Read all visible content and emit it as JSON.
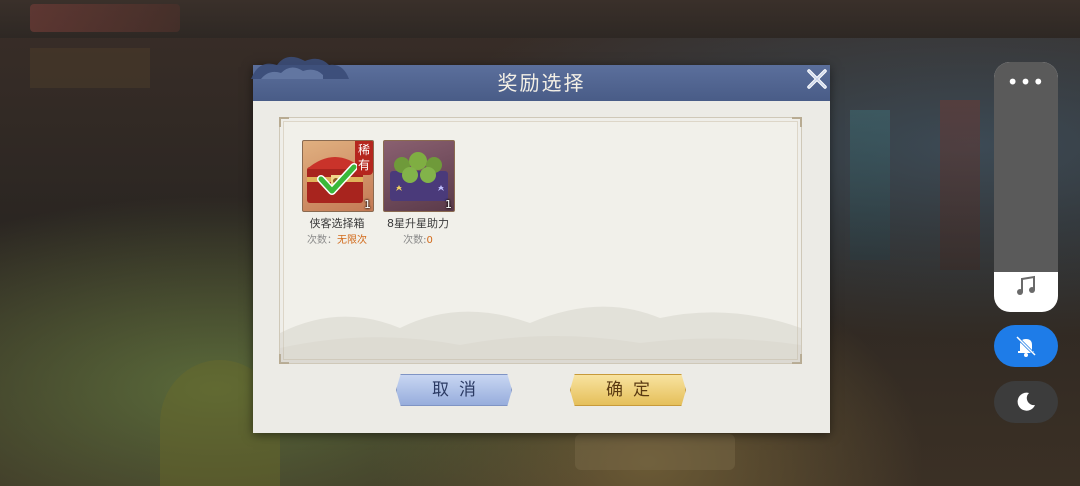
{
  "dialog": {
    "title": "奖励选择",
    "close_icon": "close-icon",
    "items": [
      {
        "name": "侠客选择箱",
        "quantity": "1",
        "badge": "稀有",
        "uses_label": "次数：",
        "uses_value": "无限次",
        "selected": true,
        "icon": "treasure-chest-icon"
      },
      {
        "name": "8星升星助力",
        "quantity": "1",
        "uses_label": "次数:",
        "uses_value": "0",
        "selected": false,
        "icon": "upgrade-pack-icon"
      }
    ],
    "cancel_label": "取消",
    "confirm_label": "确定"
  },
  "system_controls": {
    "more_label": "•••",
    "icons": [
      "music-note-icon",
      "mute-bell-icon",
      "moon-icon"
    ]
  },
  "colors": {
    "header": "#4f628d",
    "cancel": "#a9bde6",
    "confirm": "#eecb70",
    "accent_blue": "#1e7ce8",
    "uses_highlight": "#d26a1a"
  }
}
